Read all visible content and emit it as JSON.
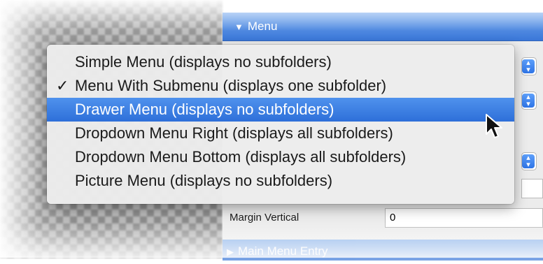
{
  "inspector": {
    "section_title": "Menu",
    "section_collapsed_title": "Main Menu Entry",
    "margin_vertical_label": "Margin Vertical",
    "margin_vertical_value": "0"
  },
  "menu": {
    "items": [
      {
        "label": "Simple Menu (displays no subfolders)",
        "checked": false,
        "highlighted": false
      },
      {
        "label": "Menu With Submenu (displays one subfolder)",
        "checked": true,
        "highlighted": false
      },
      {
        "label": "Drawer Menu (displays no subfolders)",
        "checked": false,
        "highlighted": true
      },
      {
        "label": "Dropdown Menu Right (displays all subfolders)",
        "checked": false,
        "highlighted": false
      },
      {
        "label": "Dropdown Menu Bottom (displays all subfolders)",
        "checked": false,
        "highlighted": false
      },
      {
        "label": "Picture Menu (displays no subfolders)",
        "checked": false,
        "highlighted": false
      }
    ],
    "check_glyph": "✓"
  },
  "icons": {
    "section_expanded": "triangle-down-icon",
    "section_collapsed": "triangle-right-icon",
    "popup_stepper": "up-down-chevron-icon",
    "pointer": "arrow-cursor-icon"
  },
  "colors": {
    "accent": "#2f6fd6",
    "highlight": "#3a7de3",
    "menu_bg": "#ececec"
  }
}
